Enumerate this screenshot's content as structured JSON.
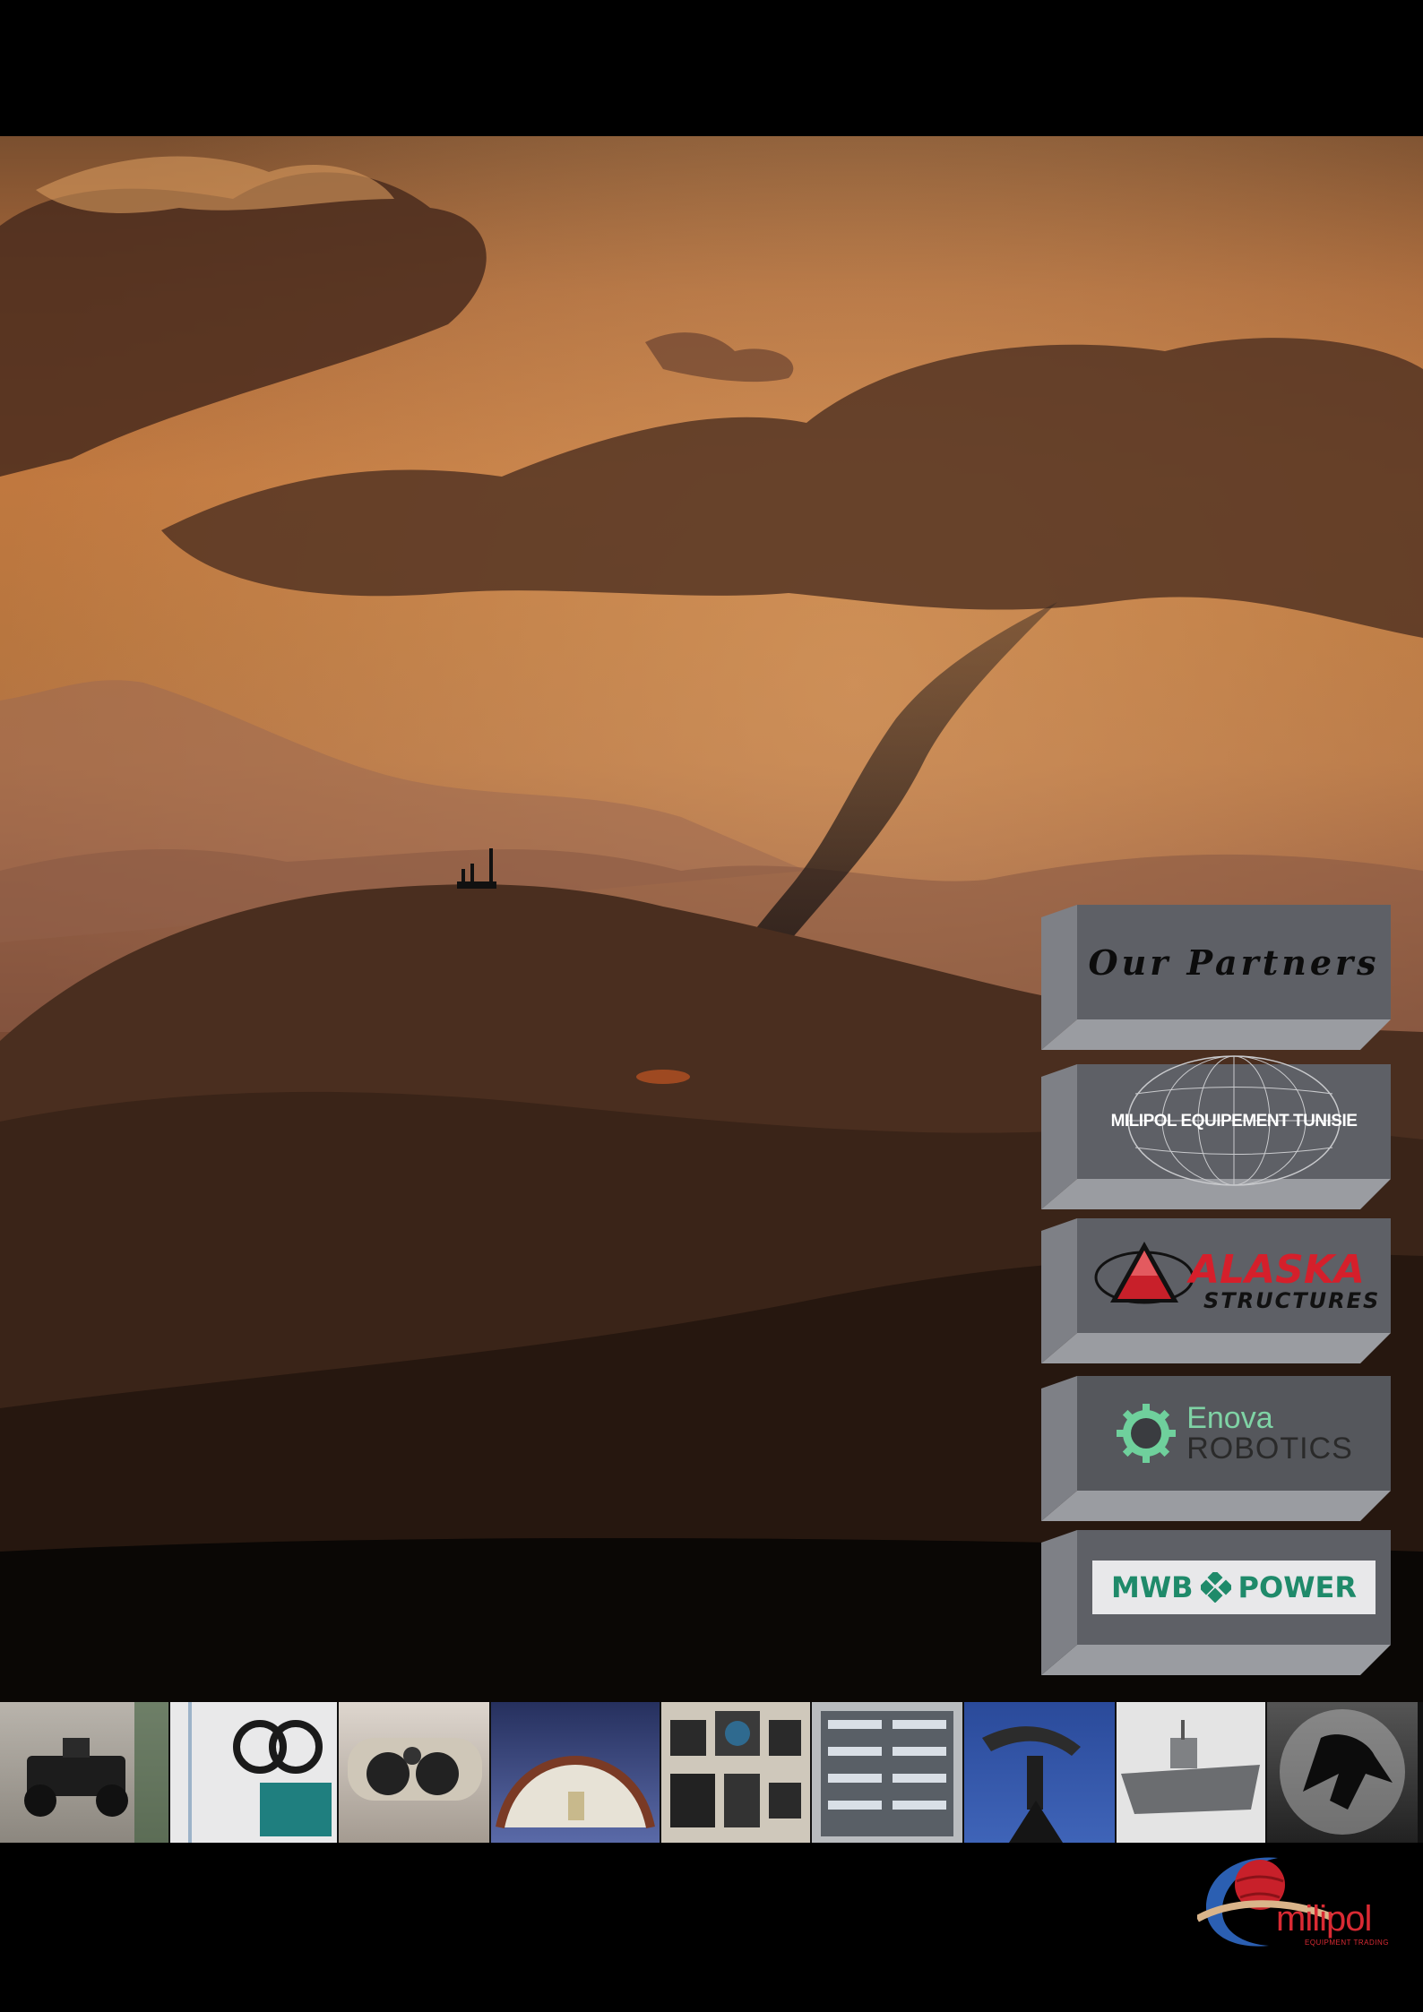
{
  "partners": {
    "title": "Our Partners",
    "items": [
      {
        "name": "MILIPOL EQUIPEMENT TUNISIE"
      },
      {
        "name_line1": "ALASKA",
        "name_line2": "STRUCTURES"
      },
      {
        "name_line1": "Enova",
        "name_line2": "ROBOTICS"
      },
      {
        "name_left": "MWB",
        "name_right": "POWER"
      }
    ]
  },
  "gallery": {
    "items": [
      "robot-vehicle",
      "cable-equipment",
      "rangefinder-binoculars",
      "shelter-tent",
      "avionics-instruments",
      "electronic-racks",
      "radar-antenna",
      "naval-ship",
      "dark-figure"
    ]
  },
  "footer_logo": {
    "word": "milipol",
    "tagline": "EQUIPMENT TRADING"
  },
  "colors": {
    "accent_red": "#d92a33",
    "tile_face": "#5e6066",
    "enova_green": "#7fd3a5",
    "mwb_green": "#1f8a6a"
  }
}
